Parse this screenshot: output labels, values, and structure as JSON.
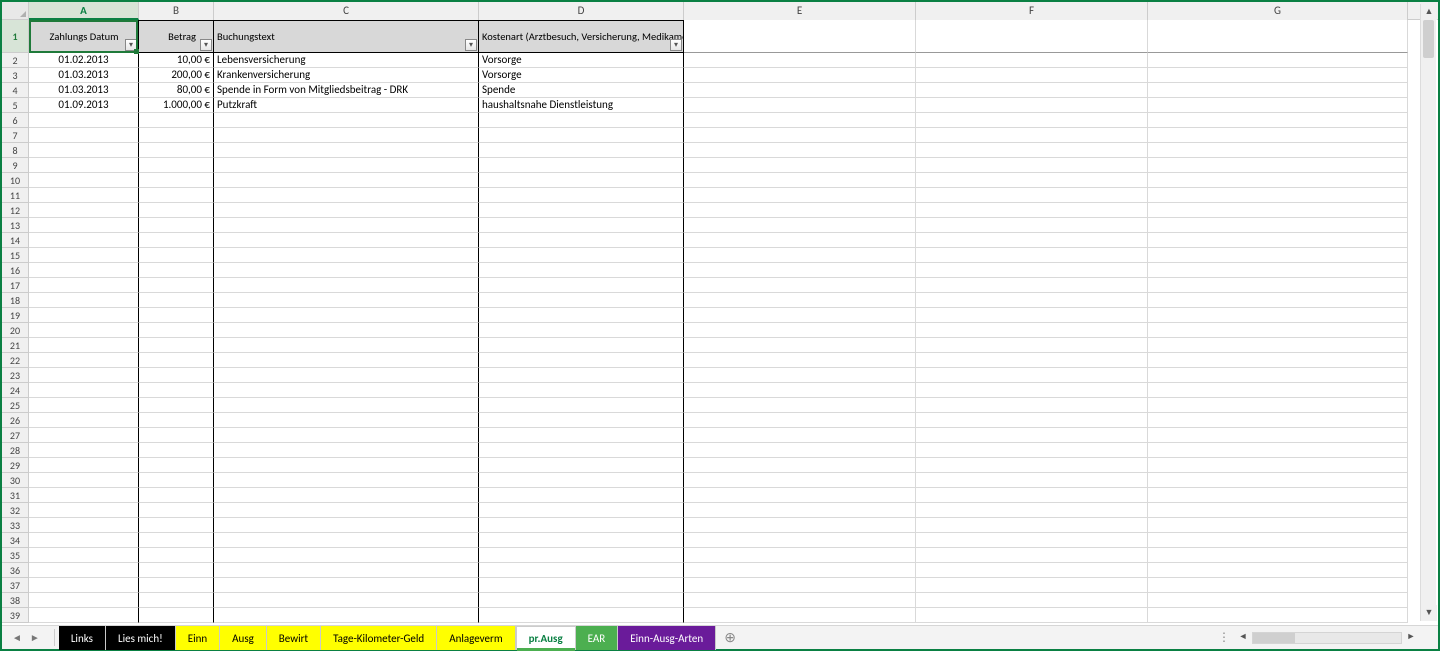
{
  "columns": [
    "A",
    "B",
    "C",
    "D",
    "E",
    "F",
    "G"
  ],
  "headers": {
    "A": "Zahlungs Datum",
    "B": "Betrag",
    "C": "Buchungstext",
    "D": "Kostenart (Arztbesuch, Versicherung, Medikamente,"
  },
  "rows": [
    {
      "A": "01.02.2013",
      "B": "10,00 €",
      "C": "Lebensversicherung",
      "D": "Vorsorge"
    },
    {
      "A": "01.03.2013",
      "B": "200,00 €",
      "C": "Krankenversicherung",
      "D": "Vorsorge"
    },
    {
      "A": "01.03.2013",
      "B": "80,00 €",
      "C": "Spende in Form von Mitgliedsbeitrag - DRK",
      "D": "Spende"
    },
    {
      "A": "01.09.2013",
      "B": "1.000,00 €",
      "C": "Putzkraft",
      "D": "haushaltsnahe Dienstleistung"
    }
  ],
  "row_count": 39,
  "tabs": [
    {
      "label": "Links",
      "style": "black"
    },
    {
      "label": "Lies mich!",
      "style": "black"
    },
    {
      "label": "Einn",
      "style": "yellow"
    },
    {
      "label": "Ausg",
      "style": "yellow"
    },
    {
      "label": "Bewirt",
      "style": "yellow"
    },
    {
      "label": "Tage-Kilometer-Geld",
      "style": "yellow"
    },
    {
      "label": "Anlageverm",
      "style": "yellow"
    },
    {
      "label": "pr.Ausg",
      "style": "active"
    },
    {
      "label": "EAR",
      "style": "green"
    },
    {
      "label": "Einn-Ausg-Arten",
      "style": "purple"
    }
  ],
  "selected_cell": "A1",
  "filter_glyph": "▾"
}
